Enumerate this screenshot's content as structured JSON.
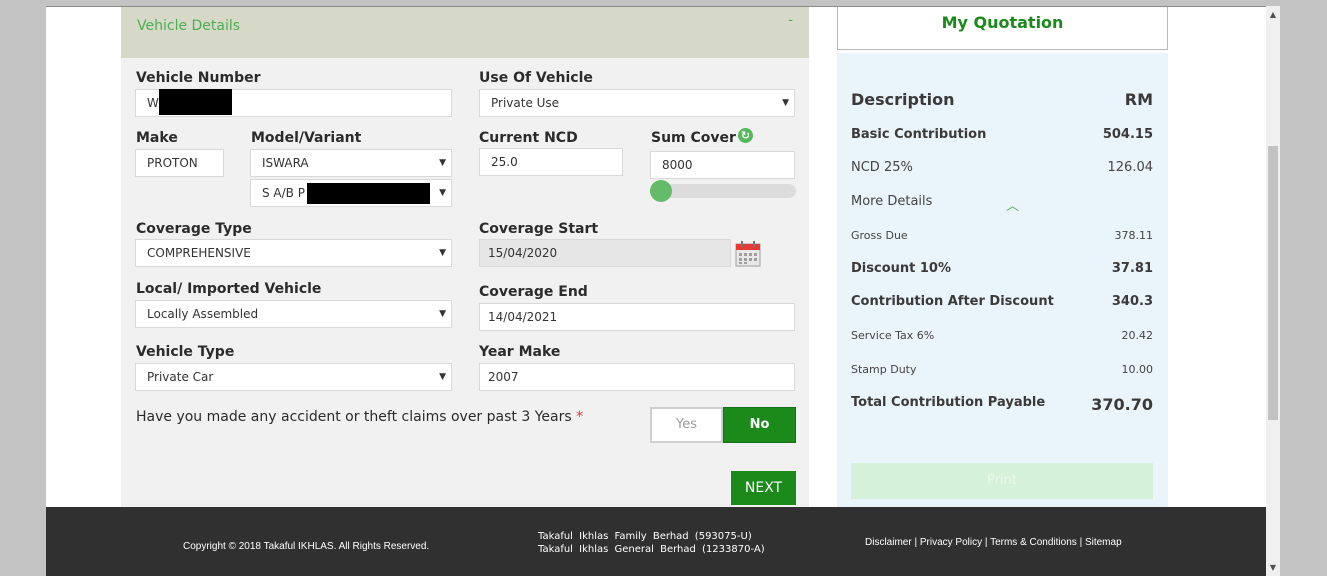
{
  "form": {
    "header_title": "Vehicle Details",
    "header_toggle": "-",
    "vehicle_number": {
      "label": "Vehicle Number",
      "value": "W"
    },
    "use_of_vehicle": {
      "label": "Use Of Vehicle",
      "value": "Private Use"
    },
    "make": {
      "label": "Make",
      "value": "PROTON"
    },
    "model_variant": {
      "label": "Model/Variant",
      "model": "ISWARA",
      "variant": "S A/B P"
    },
    "current_ncd": {
      "label": "Current NCD",
      "value": "25.0"
    },
    "sum_cover": {
      "label": "Sum Cover",
      "value": "8000",
      "slider_level_fraction": 0.05
    },
    "coverage_type": {
      "label": "Coverage Type",
      "value": "COMPREHENSIVE"
    },
    "coverage_start": {
      "label": "Coverage Start",
      "value": "15/04/2020"
    },
    "local_imported": {
      "label": "Local/ Imported Vehicle",
      "value": "Locally Assembled"
    },
    "coverage_end": {
      "label": "Coverage End",
      "value": "14/04/2021"
    },
    "vehicle_type": {
      "label": "Vehicle Type",
      "value": "Private Car"
    },
    "year_make": {
      "label": "Year Make",
      "value": "2007"
    },
    "claims_question": "Have you made any accident or theft claims over past 3 Years",
    "required_mark": "*",
    "yes_label": "Yes",
    "no_label": "No",
    "next_label": "NEXT",
    "icons": {
      "dropdown": "chevron-down-icon",
      "refresh": "refresh-icon",
      "calendar": "calendar-icon"
    }
  },
  "quotation": {
    "title": "My Quotation",
    "header": {
      "description": "Description",
      "currency": "RM"
    },
    "basic_contribution": {
      "label": "Basic Contribution",
      "value": "504.15"
    },
    "ncd": {
      "label": "NCD 25%",
      "value": "126.04"
    },
    "more_details": "More Details",
    "gross_due": {
      "label": "Gross Due",
      "value": "378.11"
    },
    "discount": {
      "label": "Discount 10%",
      "value": "37.81"
    },
    "after_discount": {
      "label": "Contribution After Discount",
      "value": "340.3"
    },
    "service_tax": {
      "label": "Service Tax 6%",
      "value": "20.42"
    },
    "stamp_duty": {
      "label": "Stamp Duty",
      "value": "10.00"
    },
    "total": {
      "label": "Total Contribution Payable",
      "value": "370.70"
    },
    "print_label": "Print"
  },
  "footer": {
    "copyright": "Copyright © 2018 Takaful IKHLAS. All Rights Reserved.",
    "company_line_1": "Takaful Ikhlas Family Berhad (593075-U)",
    "company_line_2": "Takaful Ikhlas General Berhad (1233870-A)",
    "links": [
      "Disclaimer",
      "Privacy Policy",
      "Terms & Conditions",
      "Sitemap"
    ]
  },
  "colors": {
    "accent_green": "#1b8a1b",
    "header_green_text": "#4caf50",
    "quote_bg": "#eaf4fb",
    "footer_bg": "#303030"
  }
}
